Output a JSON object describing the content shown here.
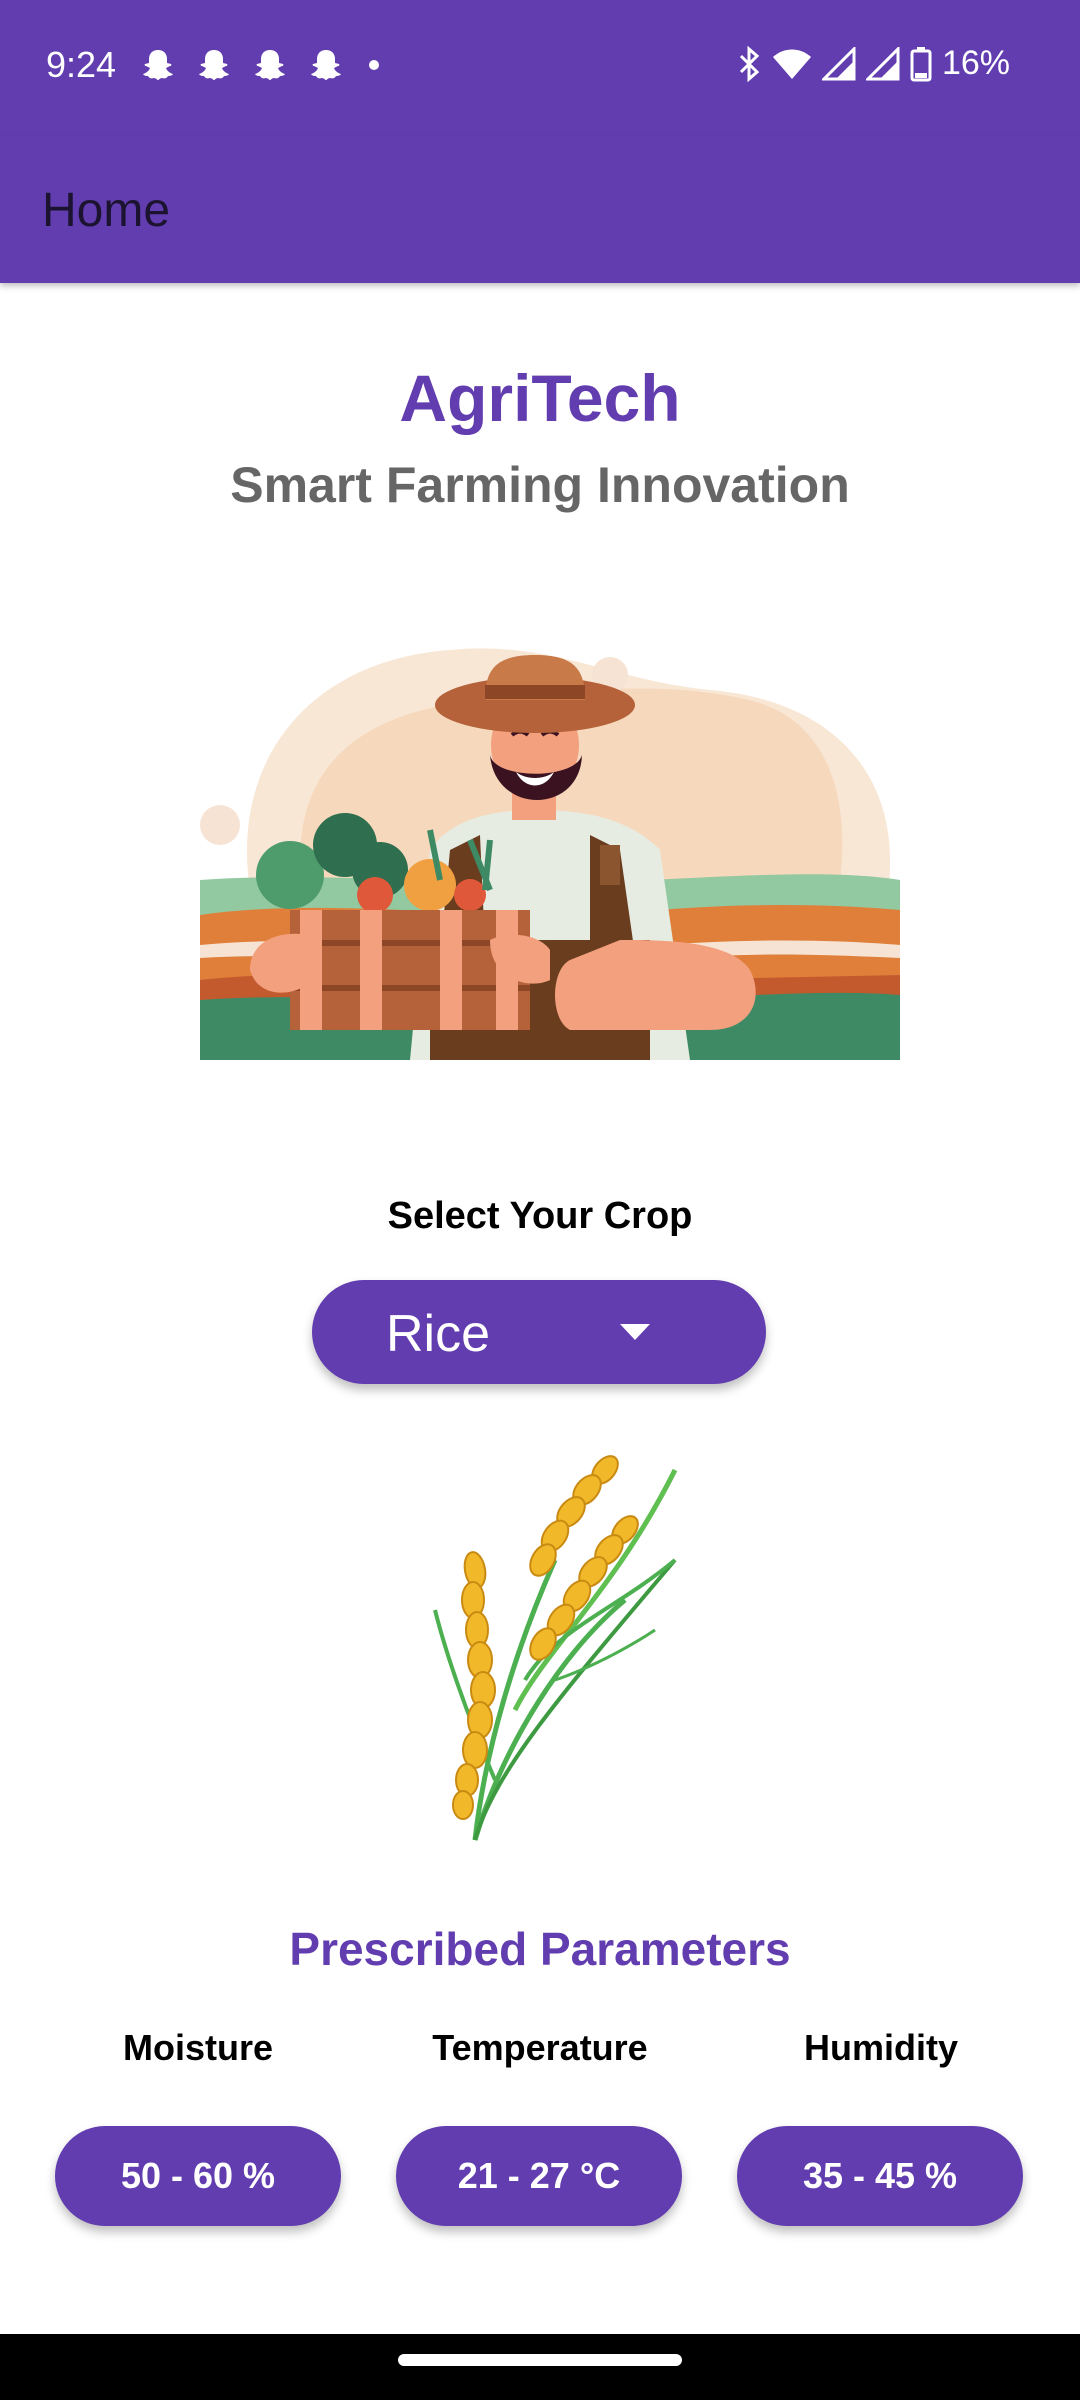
{
  "status_bar": {
    "time": "9:24",
    "notification_icons": [
      "snapchat-icon",
      "snapchat-icon",
      "snapchat-icon",
      "snapchat-icon",
      "dot-icon"
    ],
    "right_icons": [
      "bluetooth-icon",
      "wifi-icon",
      "signal-icon",
      "signal-icon",
      "battery-icon"
    ],
    "battery": "16%"
  },
  "app_bar": {
    "title": "Home"
  },
  "header": {
    "title": "AgriTech",
    "subtitle": "Smart Farming Innovation"
  },
  "crop_selector": {
    "label": "Select Your Crop",
    "selected": "Rice"
  },
  "parameters": {
    "title": "Prescribed Parameters",
    "items": [
      {
        "label": "Moisture",
        "value": "50 - 60 %"
      },
      {
        "label": "Temperature",
        "value": "21 - 27 °C"
      },
      {
        "label": "Humidity",
        "value": "35 - 45 %"
      }
    ]
  },
  "colors": {
    "primary": "#623db0",
    "subtitle": "#666666",
    "background": "#ffffff"
  }
}
